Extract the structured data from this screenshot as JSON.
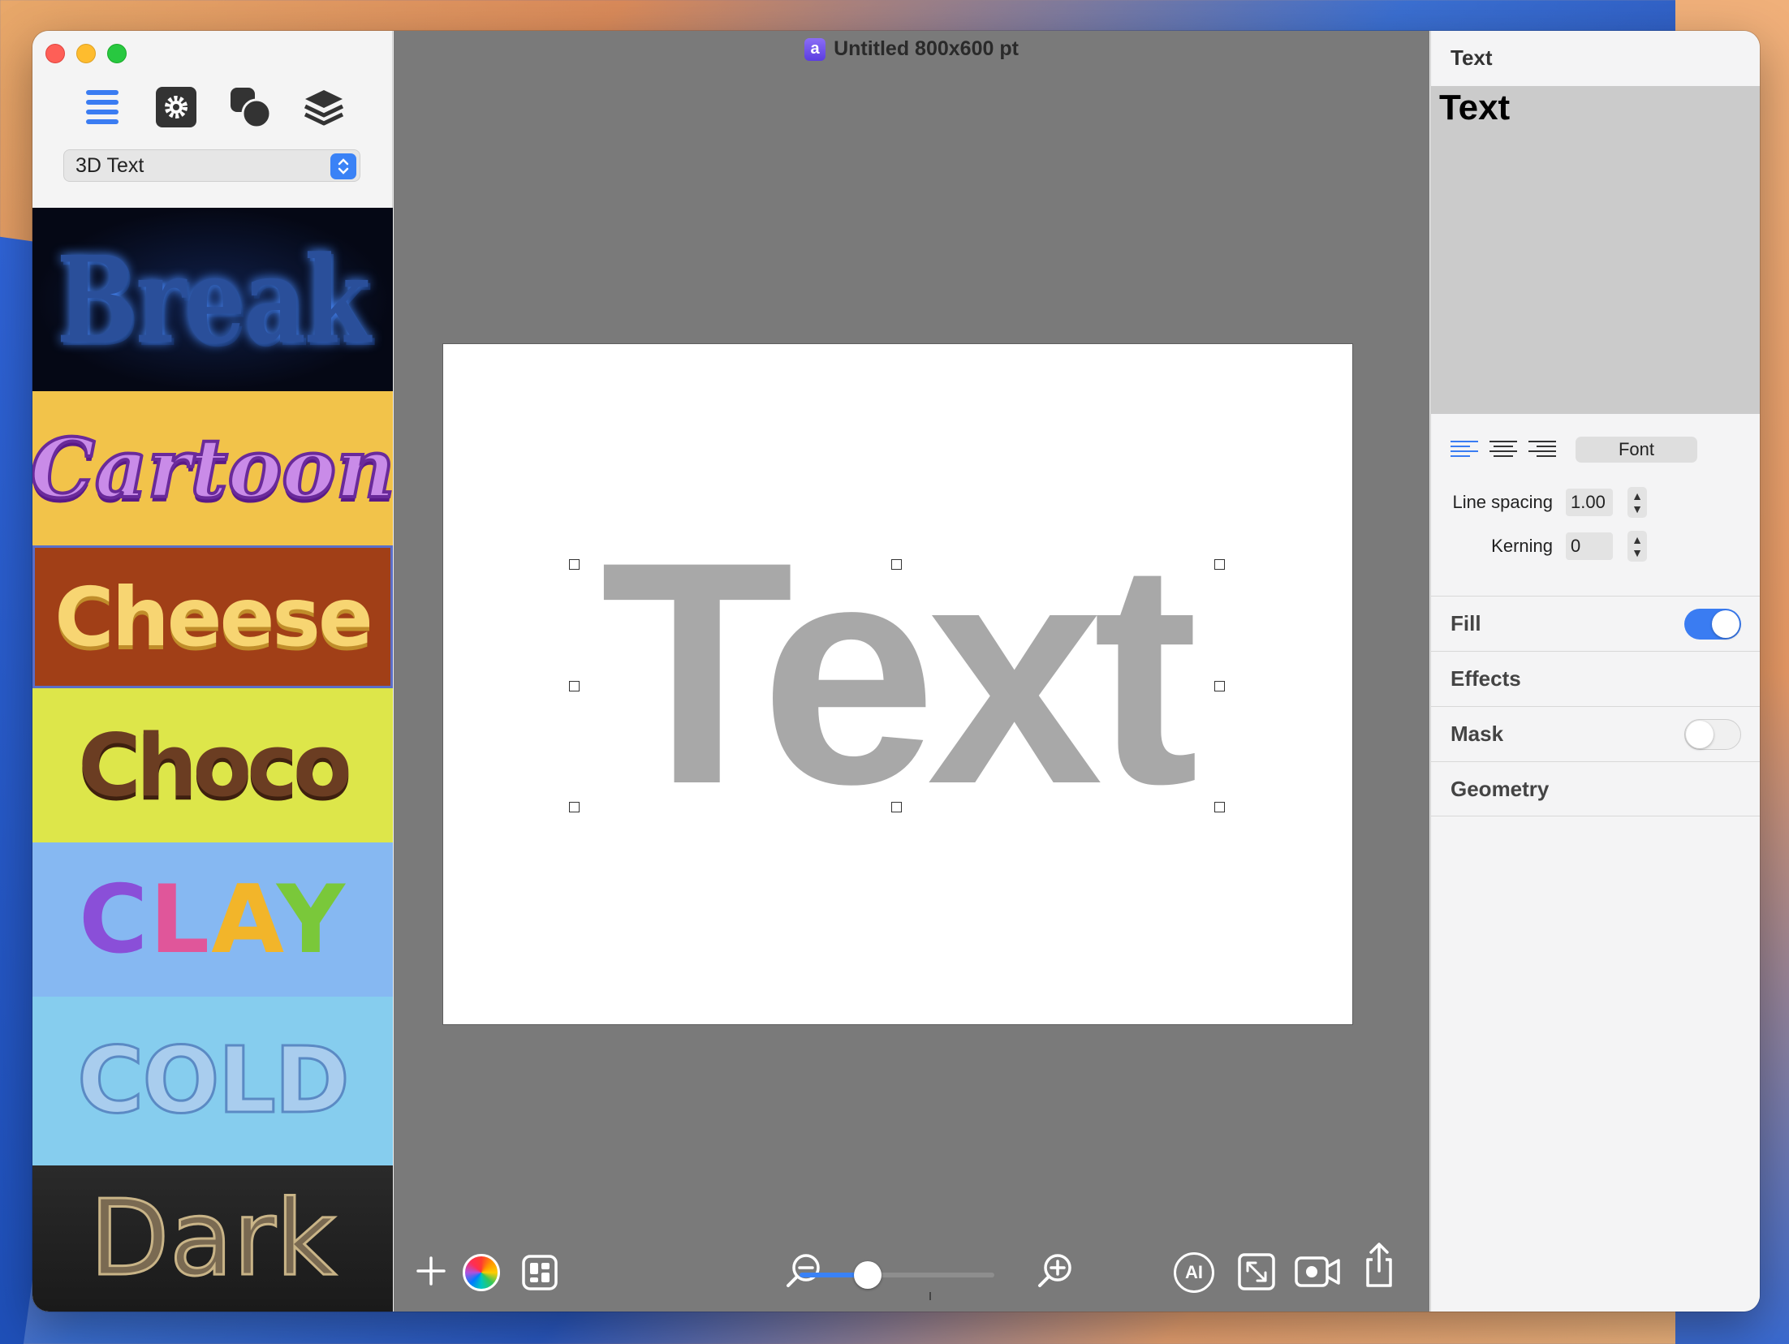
{
  "window": {
    "title": "Untitled 800x600 pt"
  },
  "sidebar": {
    "toolbar": [
      {
        "name": "list-icon"
      },
      {
        "name": "gear-icon"
      },
      {
        "name": "shapes-icon"
      },
      {
        "name": "layers-icon"
      }
    ],
    "category_select": {
      "value": "3D Text"
    },
    "presets": [
      {
        "id": "break",
        "label": "Break"
      },
      {
        "id": "cartoon",
        "label": "Cartoon"
      },
      {
        "id": "cheese",
        "label": "Cheese"
      },
      {
        "id": "choco",
        "label": "Choco"
      },
      {
        "id": "clay",
        "label": "CLAY"
      },
      {
        "id": "cold",
        "label": "COLD"
      },
      {
        "id": "dark",
        "label": "Dark"
      }
    ]
  },
  "canvas": {
    "text": "Text",
    "zoom_fraction": 0.35
  },
  "bottom_bar": {
    "icons": [
      "plus-icon",
      "color-wheel-icon",
      "grid-icon",
      "zoom-out-icon",
      "zoom-in-icon",
      "ai-icon",
      "resize-icon",
      "video-icon",
      "share-icon"
    ],
    "ai_label": "AI"
  },
  "inspector": {
    "header": "Text",
    "preview_text": "Text",
    "font_button": "Font",
    "line_spacing": {
      "label": "Line spacing",
      "value": "1.00"
    },
    "kerning": {
      "label": "Kerning",
      "value": "0"
    },
    "sections": [
      {
        "label": "Fill",
        "toggle": true
      },
      {
        "label": "Effects"
      },
      {
        "label": "Mask",
        "toggle": false
      },
      {
        "label": "Geometry"
      }
    ]
  },
  "colors": {
    "accent": "#3a82f6",
    "canvas_bg": "#7a7a7a",
    "text_fill": "#a8a8a8"
  }
}
